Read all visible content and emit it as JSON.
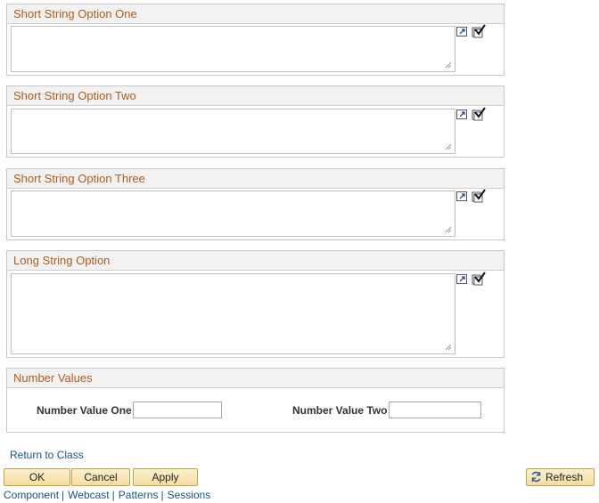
{
  "groups": [
    {
      "title": "Short String Option One",
      "value": ""
    },
    {
      "title": "Short String Option Two",
      "value": ""
    },
    {
      "title": "Short String Option Three",
      "value": ""
    },
    {
      "title": "Long String Option",
      "value": ""
    }
  ],
  "number_values": {
    "title": "Number Values",
    "field_one_label": "Number Value One",
    "field_one_value": "",
    "field_two_label": "Number Value Two",
    "field_two_value": ""
  },
  "return_link": "Return to Class",
  "buttons": {
    "ok": "OK",
    "cancel": "Cancel",
    "apply": "Apply",
    "refresh": "Refresh"
  },
  "footer_links": [
    "Component",
    "Webcast",
    "Patterns",
    "Sessions"
  ],
  "footer_separator": "|",
  "colors": {
    "header_text": "#b25b1e",
    "link": "#1e4f8e",
    "button_bg": "#f4dd9f"
  },
  "icons": {
    "expand": "expand-icon",
    "spellcheck": "spellcheck-icon",
    "refresh": "refresh-icon"
  }
}
